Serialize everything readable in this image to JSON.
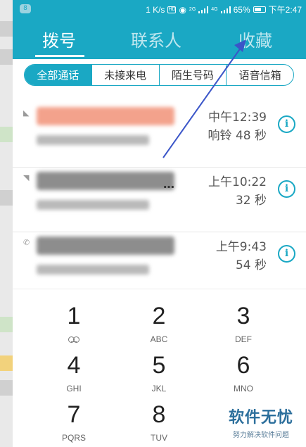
{
  "status_bar": {
    "notification_count": "8",
    "speed": "1 K/s",
    "hd": "HD",
    "net_2g": "2G",
    "net_4g": "4G",
    "battery": "65%",
    "time": "下午2:47"
  },
  "tabs": [
    {
      "label": "拨号",
      "active": true
    },
    {
      "label": "联系人",
      "active": false
    },
    {
      "label": "收藏",
      "active": false
    }
  ],
  "filters": [
    {
      "label": "全部通话",
      "active": true
    },
    {
      "label": "未接来电",
      "active": false
    },
    {
      "label": "陌生号码",
      "active": false
    },
    {
      "label": "语音信箱",
      "active": false
    }
  ],
  "calls": [
    {
      "time": "中午12:39",
      "duration": "响铃 48 秒",
      "name_color": "#f3a28c",
      "type_icon": "incoming-call-icon"
    },
    {
      "time": "上午10:22",
      "duration": "32 秒",
      "name_color": "#8d8d8d",
      "trailing": "…",
      "type_icon": "outgoing-call-icon"
    },
    {
      "time": "上午9:43",
      "duration": "54 秒",
      "name_color": "#8d8d8d",
      "type_icon": "phone-icon"
    }
  ],
  "dialpad": [
    {
      "digit": "1",
      "letters": "",
      "icon": "voicemail-icon"
    },
    {
      "digit": "2",
      "letters": "ABC"
    },
    {
      "digit": "3",
      "letters": "DEF"
    },
    {
      "digit": "4",
      "letters": "GHI"
    },
    {
      "digit": "5",
      "letters": "JKL"
    },
    {
      "digit": "6",
      "letters": "MNO"
    },
    {
      "digit": "7",
      "letters": "PQRS"
    },
    {
      "digit": "8",
      "letters": "TUV"
    }
  ],
  "watermark": {
    "title": "软件无忧",
    "subtitle": "努力解决软件问题"
  },
  "colors": {
    "accent": "#1aa8c4",
    "annotation_arrow": "#3a55c8"
  }
}
